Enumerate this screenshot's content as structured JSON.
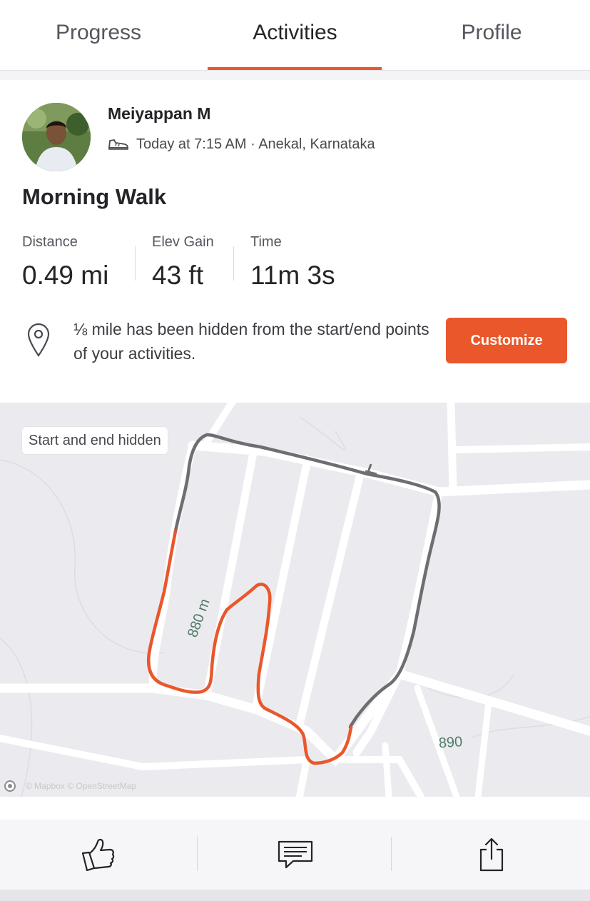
{
  "tabs": [
    {
      "label": "Progress"
    },
    {
      "label": "Activities",
      "active": true
    },
    {
      "label": "Profile"
    }
  ],
  "activity": {
    "athlete_name": "Meiyappan M",
    "activity_icon": "walking-shoe-icon",
    "meta": "Today at 7:15 AM · Anekal, Karnataka",
    "title": "Morning Walk",
    "stats": [
      {
        "label": "Distance",
        "value": "0.49 mi"
      },
      {
        "label": "Elev Gain",
        "value": "43 ft"
      },
      {
        "label": "Time",
        "value": "11m 3s"
      }
    ],
    "privacy_notice": "⅛ mile has been hidden from the start/end points of your activities.",
    "customize_label": "Customize"
  },
  "map": {
    "badge": "Start and end hidden",
    "contour_labels": [
      "880 m",
      "890"
    ],
    "attribution": "© Mapbox © OpenStreetMap",
    "route_colors": {
      "visible": "#e9572b",
      "hidden": "#6d6d72"
    }
  },
  "actions": [
    {
      "icon": "thumbs-up-icon"
    },
    {
      "icon": "comment-icon"
    },
    {
      "icon": "share-icon"
    }
  ],
  "colors": {
    "accent": "#e9572b",
    "text": "#242428"
  }
}
